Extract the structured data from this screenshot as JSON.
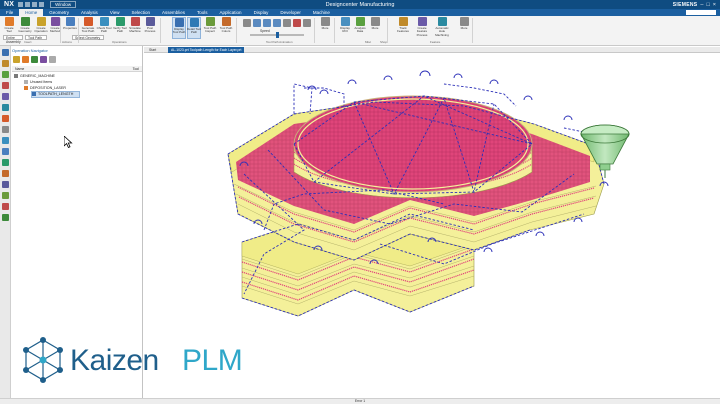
{
  "app": {
    "logo": "NX",
    "window_selector": "Window",
    "title": "Designcenter Manufacturing",
    "brand": "SIEMENS",
    "user_label": "Jlammers Siemens"
  },
  "menu": {
    "tabs": [
      "File",
      "Home",
      "Geometry",
      "Analysis",
      "View",
      "Selection",
      "Assemblies",
      "Tools",
      "Application",
      "Display",
      "Developer",
      "Machine"
    ],
    "active_tab": "Home"
  },
  "ribbon": {
    "buttons": [
      {
        "label": "Create Tool",
        "color": "#e07b2a"
      },
      {
        "label": "Create Geometry",
        "color": "#3c8a3a"
      },
      {
        "label": "Create Operation",
        "color": "#c9a22b"
      },
      {
        "label": "Create Method",
        "color": "#7a4ea0"
      },
      {
        "label": "Properties",
        "color": "#4a7fbf"
      },
      {
        "label": "Generate Tool Path",
        "color": "#d55a2a"
      },
      {
        "label": "Check Tool Path",
        "color": "#3a8fbf"
      },
      {
        "label": "Verify Tool Path",
        "color": "#2a9a6a"
      },
      {
        "label": "Simulate Machine",
        "color": "#bf4a4a"
      },
      {
        "label": "Post Process",
        "color": "#5a5a9a"
      },
      {
        "label": "Display Tool Path",
        "color": "#3a6fb0"
      },
      {
        "label": "Detail Tool Path",
        "color": "#2f7ab5"
      },
      {
        "label": "Tool Path Inspect",
        "color": "#6a9a3a"
      },
      {
        "label": "Tool Path Colors",
        "color": "#c46a2a"
      },
      {
        "label": "More",
        "color": "#8a8a8a"
      },
      {
        "label": "Display ROI",
        "color": "#4a90c0"
      },
      {
        "label": "Analysis Data",
        "color": "#5aa040"
      },
      {
        "label": "More",
        "color": "#8a8a8a"
      },
      {
        "label": "Track Features",
        "color": "#c08a2a"
      },
      {
        "label": "Create Feature Process",
        "color": "#6a5aa8"
      },
      {
        "label": "Automatic Hole Machining",
        "color": "#2a8aa0"
      },
      {
        "label": "More",
        "color": "#8a8a8a"
      }
    ],
    "groups": [
      "Insert",
      "Actions",
      "Operations",
      "Tool Path Animation",
      "Misc",
      "Shop",
      "Feature"
    ],
    "filter_dropdowns": [
      "Entire Assembly",
      "Tool Path",
      "Select Geometry"
    ],
    "speed_label": "Speed"
  },
  "navigator": {
    "title": "Operation Navigator",
    "columns": [
      "Name",
      "Tool"
    ],
    "tree": [
      {
        "label": "GENERIC_MACHINE",
        "level": 0
      },
      {
        "label": "Unused Items",
        "level": 1
      },
      {
        "label": "DEPOSITION_LASER",
        "level": 1
      },
      {
        "label": "TOOLPATH_LENGTH",
        "level": 2,
        "selected": true
      }
    ]
  },
  "graphics": {
    "tabs": [
      "Start",
      "AL-1023.prt Toolpath Length for Each Layer.prt"
    ],
    "active_tab": 1
  },
  "status": {
    "text": "Error 1"
  },
  "watermark": {
    "word1": "Kaizen",
    "word2": "PLM",
    "primary": "#1f5f8b",
    "accent": "#2fa7c9"
  },
  "colors": {
    "titlebar": "#0f4c81",
    "menubar": "#1b5fa0",
    "path_blue": "#2b2fb8",
    "layer_magenta": "#e0457a",
    "layer_yellow": "#f4f09a",
    "nozzle_green": "#9bd39a"
  }
}
